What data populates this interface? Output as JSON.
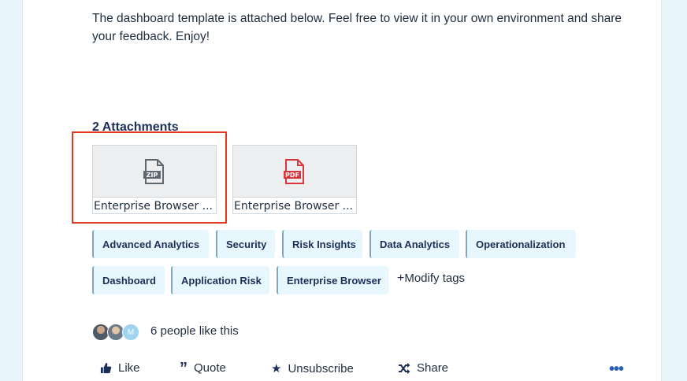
{
  "post": {
    "body": "The dashboard template is attached below. Feel free to view it in your own environment and share your feedback. Enjoy!"
  },
  "attachments": {
    "title": "2 Attachments",
    "items": [
      {
        "type_label": "ZIP",
        "name": "Enterprise Browser ...",
        "icon": "zip-file-icon"
      },
      {
        "type_label": "PDF",
        "name": "Enterprise Browser ...",
        "icon": "pdf-file-icon"
      }
    ]
  },
  "tags": {
    "items": [
      "Advanced Analytics",
      "Security",
      "Risk Insights",
      "Data Analytics",
      "Operationalization",
      "Dashboard",
      "Application Risk",
      "Enterprise Browser"
    ],
    "modify_label": "Modify tags"
  },
  "likes": {
    "text": "6 people like this",
    "avatar_initial": "M"
  },
  "actions": {
    "like": "Like",
    "quote": "Quote",
    "unsubscribe": "Unsubscribe",
    "share": "Share"
  },
  "colors": {
    "accent": "#2c5fb0",
    "highlight": "#e0391e",
    "pdf": "#d9363e",
    "zip": "#5f6770",
    "tag_bg": "#e8f7fd"
  }
}
